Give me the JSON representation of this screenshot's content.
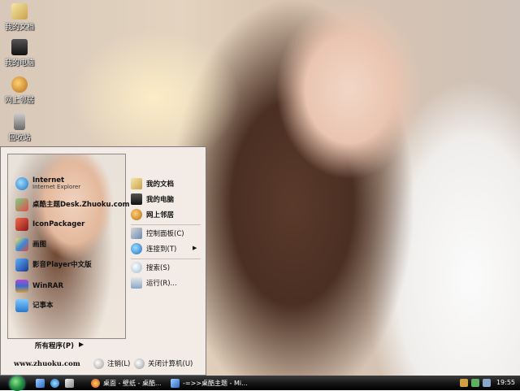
{
  "desktop": {
    "icons": [
      {
        "label": "我的文档"
      },
      {
        "label": "我的电脑"
      },
      {
        "label": "网上邻居"
      },
      {
        "label": "回收站"
      }
    ]
  },
  "start_menu": {
    "programs": [
      {
        "label": "Internet",
        "sublabel": "Internet Explorer"
      },
      {
        "label": "桌酷主题Desk.Zhuoku.com"
      },
      {
        "label": "IconPackager"
      },
      {
        "label": "画图"
      },
      {
        "label": "影音Player中文版"
      },
      {
        "label": "WinRAR"
      },
      {
        "label": "记事本"
      }
    ],
    "all_programs": "所有程序(P)",
    "website": "www.zhuoku.com",
    "places": [
      {
        "label": "我的文档"
      },
      {
        "label": "我的电脑"
      },
      {
        "label": "网上邻居"
      },
      {
        "label": "控制面板(C)"
      },
      {
        "label": "连接到(T)"
      },
      {
        "label": "搜索(S)"
      },
      {
        "label": "运行(R)..."
      }
    ],
    "logoff": "注销(L)",
    "shutdown": "关闭计算机(U)"
  },
  "taskbar": {
    "tasks": [
      {
        "label": "桌面 - 壁纸 - 桌酷..."
      },
      {
        "label": "-=>>桌酷主题 - Mi..."
      }
    ],
    "clock": "19:55"
  }
}
